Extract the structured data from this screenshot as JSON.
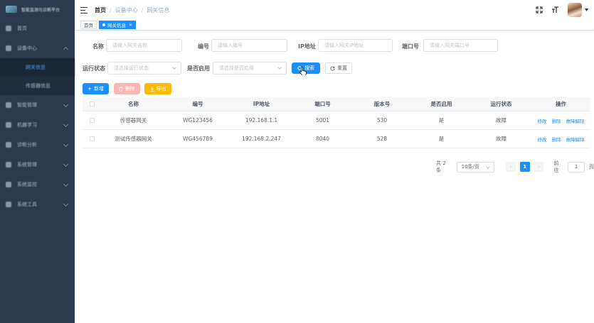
{
  "sidebar": {
    "logo_text": "智能监测与诊断平台",
    "items": [
      {
        "label": "首页"
      },
      {
        "label": "设备中心"
      },
      {
        "label": "网关信息"
      },
      {
        "label": "传感器信息"
      },
      {
        "label": "智能管理"
      },
      {
        "label": "机器学习"
      },
      {
        "label": "诊断分析"
      },
      {
        "label": "系统管理"
      },
      {
        "label": "系统监控"
      },
      {
        "label": "系统工具"
      }
    ]
  },
  "navbar": {
    "breadcrumb": [
      "首页",
      "设备中心",
      "网关信息"
    ],
    "separator": "/"
  },
  "tags": [
    {
      "label": "首页"
    },
    {
      "label": "网关信息",
      "close": "×"
    }
  ],
  "form": {
    "name_label": "名称",
    "name_placeholder": "请输入网关名称",
    "code_label": "编号",
    "code_placeholder": "请输入编号",
    "ip_label": "IP地址",
    "ip_placeholder": "请输入网关IP地址",
    "port_label": "端口号",
    "port_placeholder": "请输入网关端口号",
    "status_label": "运行状态",
    "status_placeholder": "请选择运行状态",
    "enabled_label": "是否启用",
    "enabled_placeholder": "请选择是否启用",
    "search_label": "搜索",
    "reset_label": "重置"
  },
  "toolbar": {
    "add_label": "新增",
    "delete_label": "删除",
    "export_label": "导出"
  },
  "table": {
    "headers": [
      "名称",
      "编号",
      "IP地址",
      "端口号",
      "版本号",
      "是否启用",
      "运行状态",
      "操作"
    ],
    "rows": [
      {
        "name": "传感器网关",
        "code": "WG123456",
        "ip": "192.168.1.1",
        "port": "5001",
        "version": "530",
        "enabled": "是",
        "status": "故障"
      },
      {
        "name": "测试传感器网关",
        "code": "WG456789",
        "ip": "192.168.2.247",
        "port": "8040",
        "version": "528",
        "enabled": "是",
        "status": "故障"
      }
    ],
    "ops": [
      "修改",
      "删除",
      "故障解除"
    ]
  },
  "pagination": {
    "total_text": "共 2 条",
    "page_size": "10条/页",
    "current_page": "1",
    "goto_label": "前往",
    "goto_value": "1",
    "page_suffix": "页"
  },
  "colors": {
    "primary": "#1890ff",
    "sidebar_bg": "#2b3a4c",
    "warning": "#ffba00",
    "danger_plain": "#ffb4b4"
  }
}
